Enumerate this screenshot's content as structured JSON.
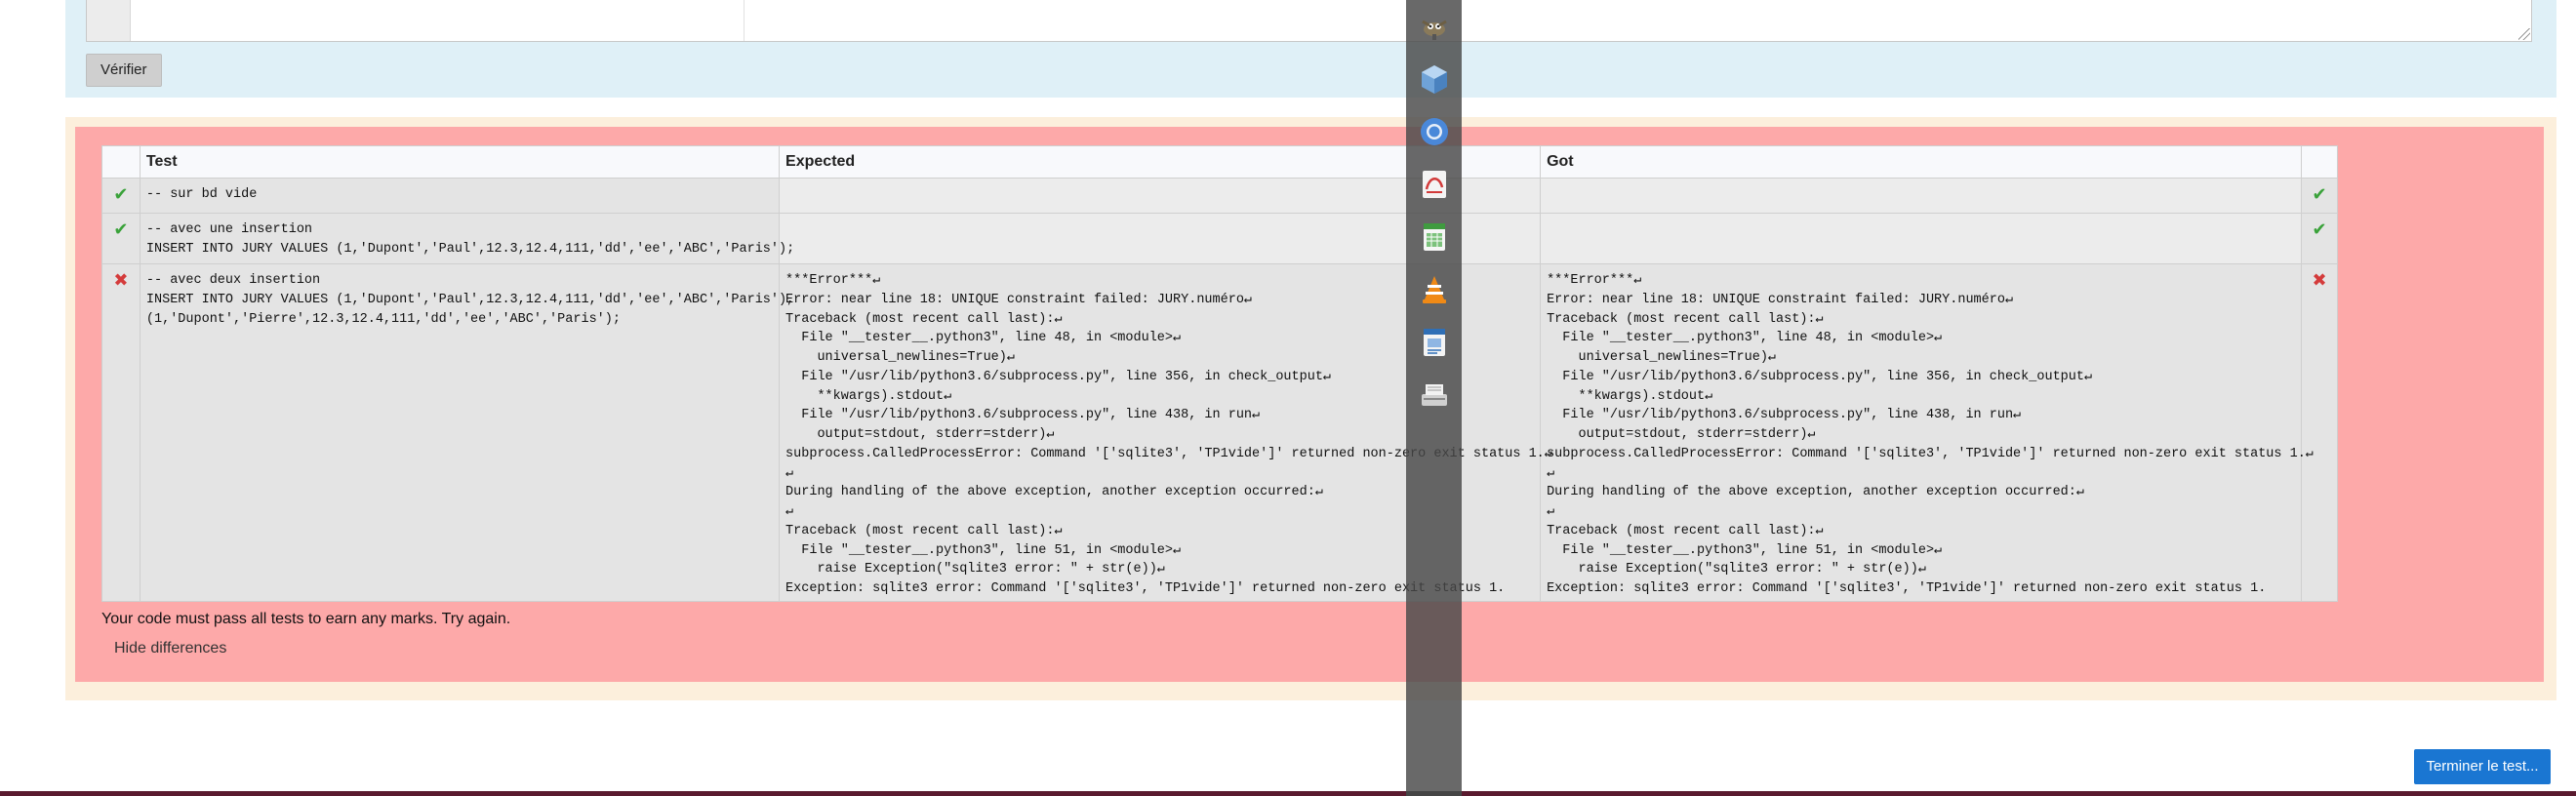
{
  "top_panel": {
    "check_button_label": "Vérifier"
  },
  "results": {
    "columns": [
      "",
      "Test",
      "Expected",
      "Got",
      ""
    ],
    "rows": [
      {
        "status": "pass",
        "status_symbol": "✔",
        "test": "-- sur bd vide",
        "expected": "",
        "got": "",
        "result_symbol": "✔"
      },
      {
        "status": "pass",
        "status_symbol": "✔",
        "test": "-- avec une insertion\nINSERT INTO JURY VALUES (1,'Dupont','Paul',12.3,12.4,111,'dd','ee','ABC','Paris');",
        "expected": "",
        "got": "",
        "result_symbol": "✔"
      },
      {
        "status": "fail",
        "status_symbol": "✖",
        "test": "-- avec deux insertion\nINSERT INTO JURY VALUES (1,'Dupont','Paul',12.3,12.4,111,'dd','ee','ABC','Paris'),\n(1,'Dupont','Pierre',12.3,12.4,111,'dd','ee','ABC','Paris');",
        "expected": "***Error***↵\nError: near line 18: UNIQUE constraint failed: JURY.numéro↵\nTraceback (most recent call last):↵\n  File \"__tester__.python3\", line 48, in <module>↵\n    universal_newlines=True)↵\n  File \"/usr/lib/python3.6/subprocess.py\", line 356, in check_output↵\n    **kwargs).stdout↵\n  File \"/usr/lib/python3.6/subprocess.py\", line 438, in run↵\n    output=stdout, stderr=stderr)↵\nsubprocess.CalledProcessError: Command '['sqlite3', 'TP1vide']' returned non-zero exit status 1.↵\n↵\nDuring handling of the above exception, another exception occurred:↵\n↵\nTraceback (most recent call last):↵\n  File \"__tester__.python3\", line 51, in <module>↵\n    raise Exception(\"sqlite3 error: \" + str(e))↵\nException: sqlite3 error: Command '['sqlite3', 'TP1vide']' returned non-zero exit status 1.",
        "got": "***Error***↵\nError: near line 18: UNIQUE constraint failed: JURY.numéro↵\nTraceback (most recent call last):↵\n  File \"__tester__.python3\", line 48, in <module>↵\n    universal_newlines=True)↵\n  File \"/usr/lib/python3.6/subprocess.py\", line 356, in check_output↵\n    **kwargs).stdout↵\n  File \"/usr/lib/python3.6/subprocess.py\", line 438, in run↵\n    output=stdout, stderr=stderr)↵\nsubprocess.CalledProcessError: Command '['sqlite3', 'TP1vide']' returned non-zero exit status 1.↵\n↵\nDuring handling of the above exception, another exception occurred:↵\n↵\nTraceback (most recent call last):↵\n  File \"__tester__.python3\", line 51, in <module>↵\n    raise Exception(\"sqlite3 error: \" + str(e))↵\nException: sqlite3 error: Command '['sqlite3', 'TP1vide']' returned non-zero exit status 1.",
        "result_symbol": "✖"
      }
    ]
  },
  "feedback": {
    "message": "Your code must pass all tests to earn any marks. Try again.",
    "toggle_label": "Hide differences"
  },
  "footer": {
    "finish_button_label": "Terminer le test..."
  },
  "dock": {
    "icons": [
      "gimp-icon",
      "3d-cube-icon",
      "chromium-icon",
      "pdf-viewer-icon",
      "spreadsheet-icon",
      "vlc-icon",
      "presentation-icon",
      "scanner-icon"
    ]
  },
  "colors": {
    "answer_panel": "#dff0f7",
    "feedback_outer": "#fcefdc",
    "feedback_inner": "#fda9a9",
    "pass": "#3aa23a",
    "fail": "#d43b3b",
    "finish_button": "#1a76d2"
  }
}
